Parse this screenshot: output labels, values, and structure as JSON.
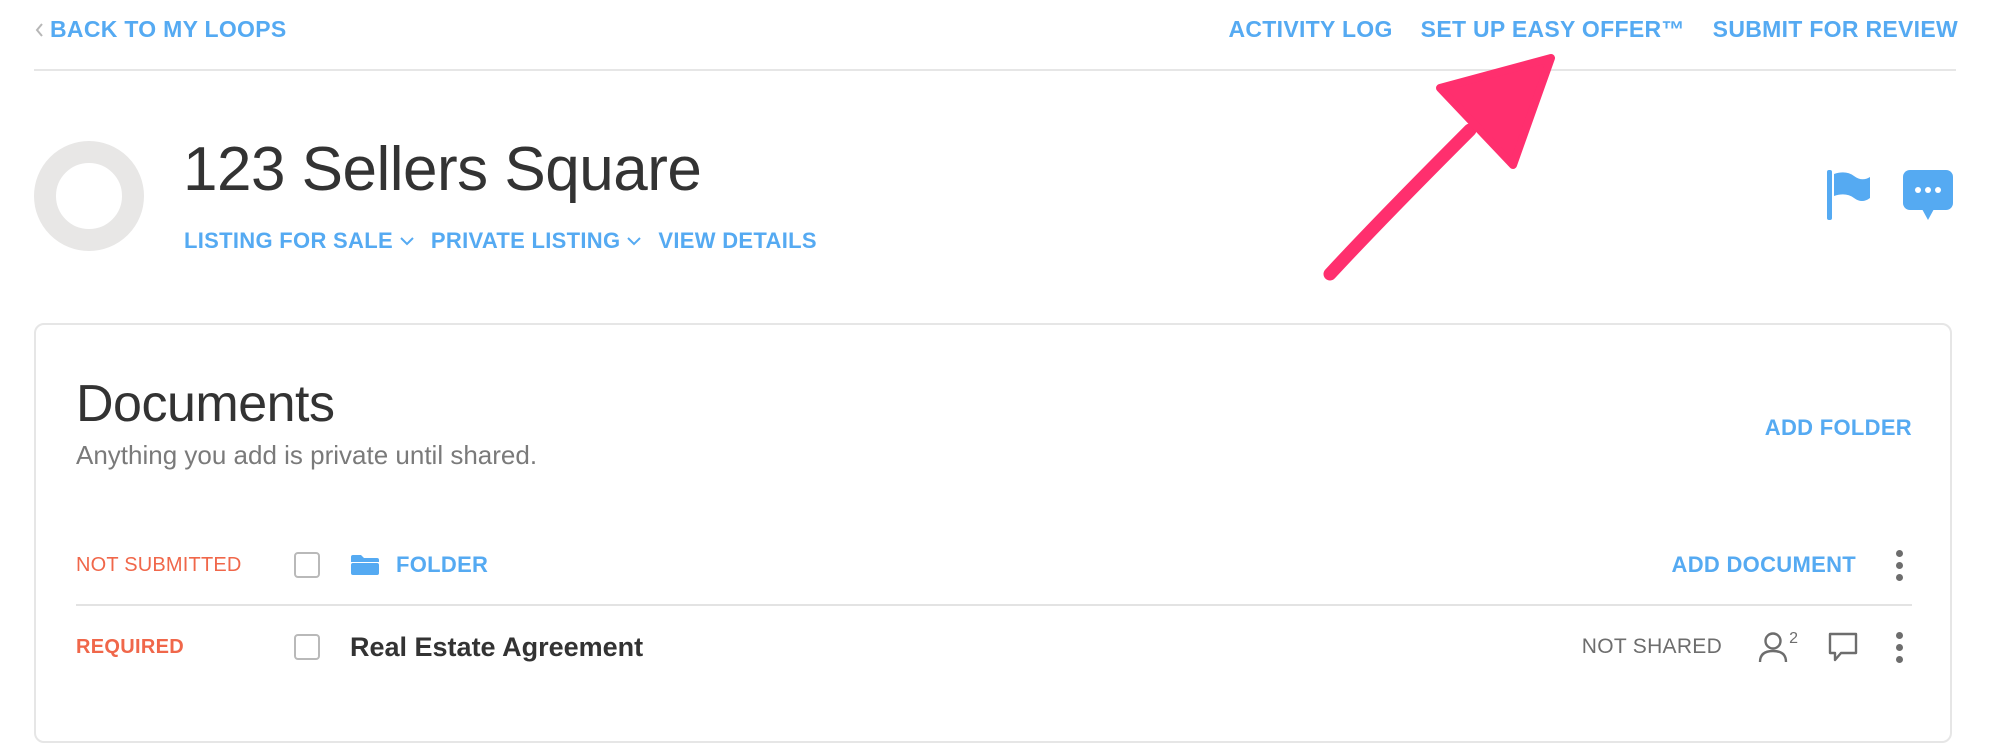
{
  "topnav": {
    "back_label": "BACK TO MY LOOPS",
    "links": [
      "ACTIVITY LOG",
      "SET UP EASY OFFER™",
      "SUBMIT FOR REVIEW"
    ]
  },
  "header": {
    "title": "123 Sellers Square",
    "status_dropdown": "LISTING FOR SALE",
    "visibility_dropdown": "PRIVATE LISTING",
    "view_details": "VIEW DETAILS"
  },
  "documents": {
    "title": "Documents",
    "subtitle": "Anything you add is private until shared.",
    "add_folder": "ADD FOLDER",
    "folder_row": {
      "status": "NOT SUBMITTED",
      "label": "FOLDER",
      "add_document": "ADD DOCUMENT"
    },
    "rows": [
      {
        "status": "REQUIRED",
        "name": "Real Estate Agreement",
        "share_status": "NOT SHARED",
        "people_count": "2"
      }
    ]
  },
  "colors": {
    "accent": "#55aaf2",
    "warning": "#f0674a",
    "annotation_arrow": "#ff2f6e"
  },
  "icons": [
    "chevron-left-icon",
    "chevron-down-icon",
    "flag-icon",
    "chat-icon",
    "folder-icon",
    "people-icon",
    "comment-icon",
    "kebab-icon",
    "annotation-arrow"
  ]
}
